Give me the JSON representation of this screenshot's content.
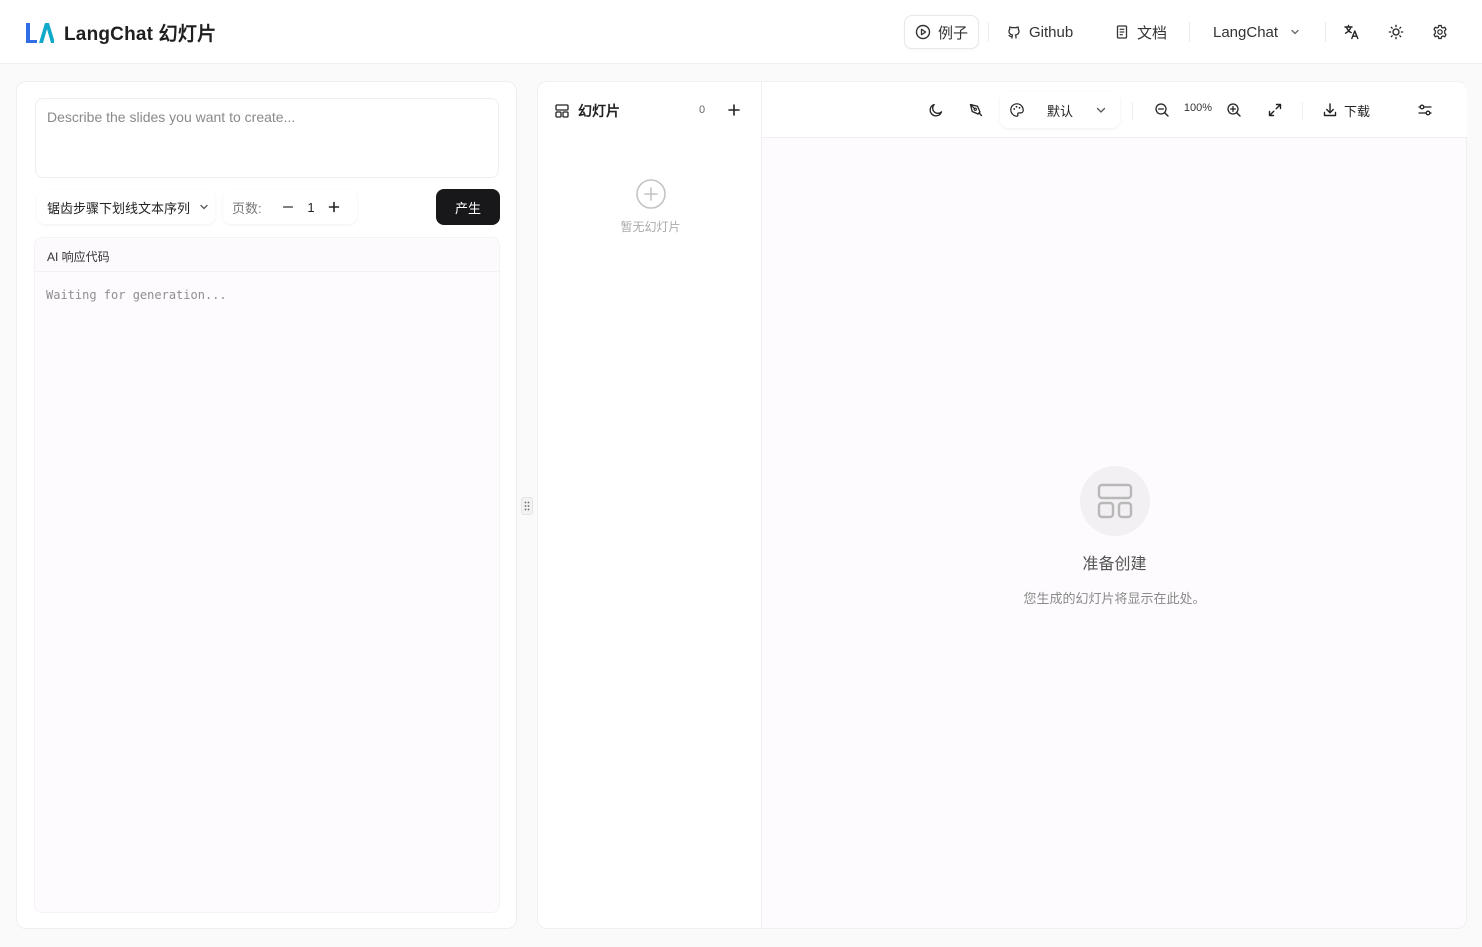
{
  "header": {
    "brand": "LangChat 幻灯片",
    "nav": {
      "examples": "例子",
      "github": "Github",
      "docs": "文档",
      "langchat": "LangChat"
    }
  },
  "editor": {
    "prompt_placeholder": "Describe the slides you want to create...",
    "template_select": "锯齿步骤下划线文本序列",
    "pages_label": "页数:",
    "pages_value": "1",
    "generate_label": "产生",
    "response_title": "AI 响应代码",
    "response_placeholder": "Waiting for generation..."
  },
  "slides": {
    "title": "幻灯片",
    "count": "0",
    "empty_text": "暂无幻灯片"
  },
  "preview": {
    "theme": "默认",
    "zoom": "100%",
    "download_label": "下载",
    "ready_title": "准备创建",
    "ready_subtitle": "您生成的幻灯片将显示在此处。"
  },
  "colors": {
    "accent_dark": "#18181b",
    "logo_blue": "#2f6ee5",
    "logo_teal": "#11a8c9"
  }
}
